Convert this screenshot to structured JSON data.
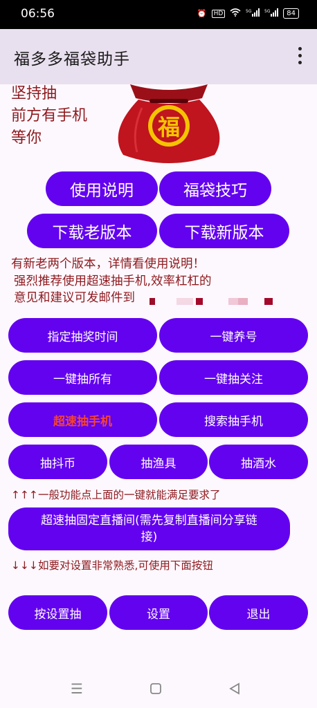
{
  "status": {
    "time": "06:56",
    "battery": "84",
    "icons": [
      "alarm-icon",
      "hd-icon",
      "wifi-icon",
      "signal-5g-icon",
      "signal-5g-icon"
    ]
  },
  "app": {
    "title": "福多多福袋助手"
  },
  "slogan": {
    "line1": "坚持抽",
    "line2": "前方有手机",
    "line3": "等你"
  },
  "buttons": {
    "usage": "使用说明",
    "tips": "福袋技巧",
    "download_old": "下载老版本",
    "download_new": "下载新版本",
    "schedule": "指定抽奖时间",
    "nurture": "一键养号",
    "draw_all": "一键抽所有",
    "draw_follow": "一键抽关注",
    "speed_phone": "超速抽手机",
    "search_phone": "搜索抽手机",
    "dou_coin": "抽抖币",
    "fishing": "抽渔具",
    "liquor": "抽酒水",
    "fixed_live": "超速抽固定直播间(需先复制直播间分享链接)",
    "by_settings": "按设置抽",
    "settings": "设置",
    "exit": "退出"
  },
  "notice": {
    "line1": "有新老两个版本，详情看使用说明！",
    "line2": "强烈推荐使用超速抽手机,效率杠杠的",
    "line3": "意见和建议可发邮件到"
  },
  "hints": {
    "up": "↑↑↑一般功能点上面的一键就能满足要求了",
    "down": "↓↓↓如要对设置非常熟悉,可使用下面按钮"
  },
  "colors": {
    "button": "#6302ef",
    "accent_text": "#8d1a1f",
    "highlight": "#f44336",
    "appbar": "#e9e0ef"
  }
}
